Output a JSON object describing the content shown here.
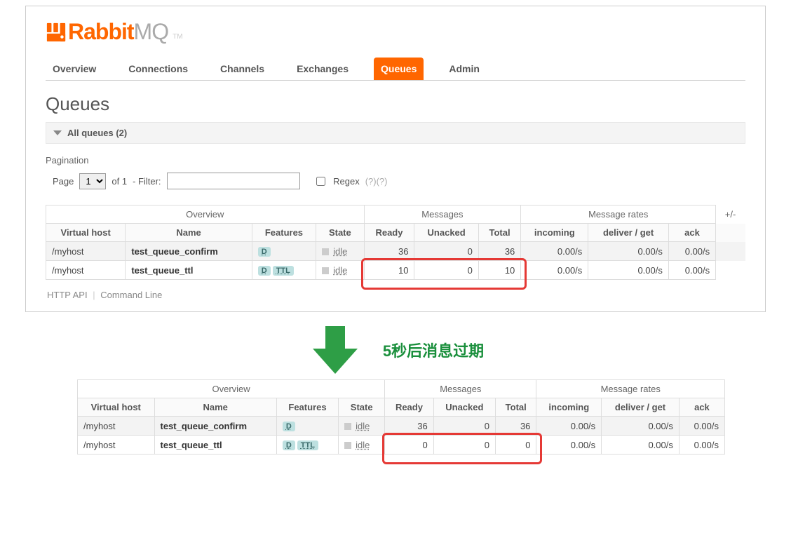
{
  "logo": {
    "text_rabbit": "Rabbit",
    "text_mq": "MQ",
    "tm": "TM"
  },
  "tabs": [
    "Overview",
    "Connections",
    "Channels",
    "Exchanges",
    "Queues",
    "Admin"
  ],
  "active_tab": "Queues",
  "page_title": "Queues",
  "section_header": "All queues (2)",
  "pagination_label": "Pagination",
  "pager": {
    "page_label": "Page",
    "page_value": "1",
    "of_label": "of 1",
    "filter_label": "- Filter:",
    "regex_label": "Regex",
    "help": "(?)(?)"
  },
  "table": {
    "group_headers": [
      "Overview",
      "Messages",
      "Message rates"
    ],
    "plusminus": "+/-",
    "col_headers": [
      "Virtual host",
      "Name",
      "Features",
      "State",
      "Ready",
      "Unacked",
      "Total",
      "incoming",
      "deliver / get",
      "ack"
    ],
    "rows_top": [
      {
        "vhost": "/myhost",
        "name": "test_queue_confirm",
        "features": [
          "D"
        ],
        "state": "idle",
        "ready": "36",
        "unacked": "0",
        "total": "36",
        "incoming": "0.00/s",
        "deliver": "0.00/s",
        "ack": "0.00/s"
      },
      {
        "vhost": "/myhost",
        "name": "test_queue_ttl",
        "features": [
          "D",
          "TTL"
        ],
        "state": "idle",
        "ready": "10",
        "unacked": "0",
        "total": "10",
        "incoming": "0.00/s",
        "deliver": "0.00/s",
        "ack": "0.00/s"
      }
    ],
    "rows_bottom": [
      {
        "vhost": "/myhost",
        "name": "test_queue_confirm",
        "features": [
          "D"
        ],
        "state": "idle",
        "ready": "36",
        "unacked": "0",
        "total": "36",
        "incoming": "0.00/s",
        "deliver": "0.00/s",
        "ack": "0.00/s"
      },
      {
        "vhost": "/myhost",
        "name": "test_queue_ttl",
        "features": [
          "D",
          "TTL"
        ],
        "state": "idle",
        "ready": "0",
        "unacked": "0",
        "total": "0",
        "incoming": "0.00/s",
        "deliver": "0.00/s",
        "ack": "0.00/s"
      }
    ]
  },
  "footer": {
    "http_api": "HTTP API",
    "cmdline": "Command Line"
  },
  "caption": "5秒后消息过期"
}
